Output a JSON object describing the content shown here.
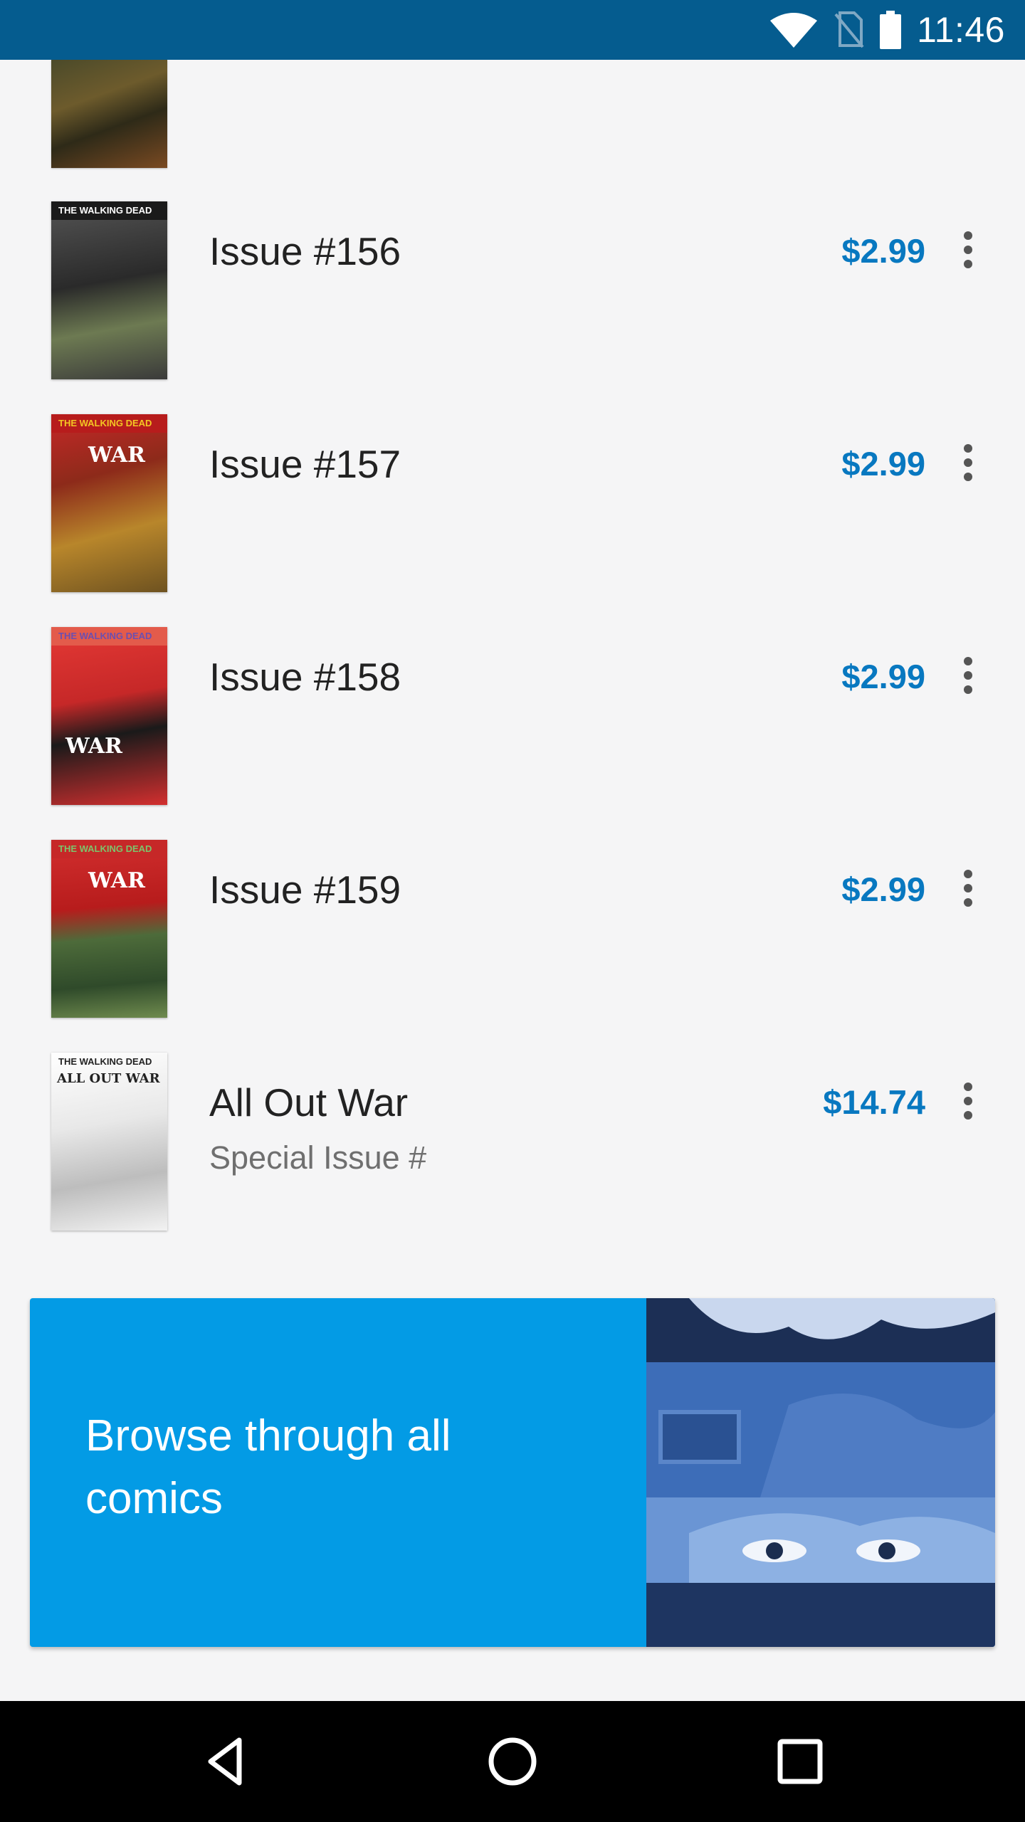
{
  "status_bar": {
    "time": "11:46",
    "icons": [
      "wifi-icon",
      "no-sim-icon",
      "battery-icon"
    ]
  },
  "issues": [
    {
      "title": "Issue #156",
      "price": "$2.99",
      "cover_masthead": "THE WALKING DEAD"
    },
    {
      "title": "Issue #157",
      "price": "$2.99",
      "cover_masthead": "THE WALKING DEAD",
      "cover_tag": "WAR"
    },
    {
      "title": "Issue #158",
      "price": "$2.99",
      "cover_masthead": "THE WALKING DEAD",
      "cover_tag": "WAR"
    },
    {
      "title": "Issue #159",
      "price": "$2.99",
      "cover_masthead": "THE WALKING DEAD",
      "cover_tag": "WAR"
    },
    {
      "title": "All Out War",
      "subtitle": "Special Issue #",
      "price": "$14.74",
      "cover_masthead": "THE WALKING DEAD",
      "cover_tag": "ALL OUT WAR"
    }
  ],
  "banner": {
    "label": "Browse through all comics"
  },
  "colors": {
    "status_bar": "#055c8f",
    "price": "#0878c0",
    "banner": "#039be5"
  },
  "nav": {
    "icons": [
      "back-icon",
      "home-icon",
      "recents-icon"
    ]
  }
}
